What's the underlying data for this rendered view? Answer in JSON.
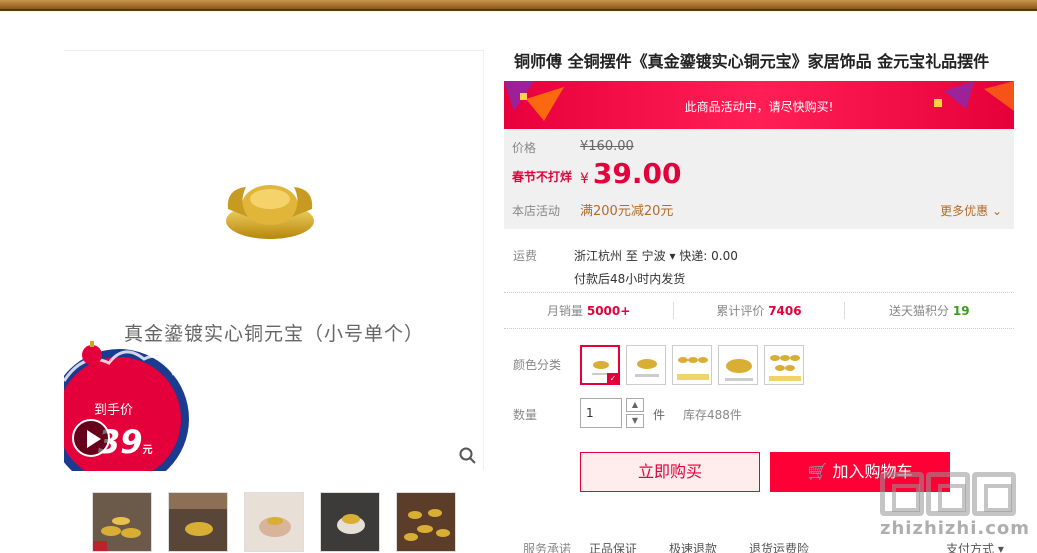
{
  "product": {
    "title": "铜师傅 全铜摆件《真金鎏镀实心铜元宝》家居饰品 金元宝礼品摆件",
    "gallery_caption": "真金鎏镀实心铜元宝（小号单个）",
    "promo_badge": {
      "label": "到手价",
      "price": "39",
      "unit": "元"
    }
  },
  "event_banner": {
    "text": "此商品活动中，请尽快购买!"
  },
  "price_panel": {
    "price_label": "价格",
    "original_price": "¥160.00",
    "promo_label": "春节不打烊",
    "currency": "¥",
    "promo_price": "39.00",
    "shop_event_label": "本店活动",
    "shop_event": "满200元减20元",
    "more_discount": "更多优惠"
  },
  "shipping": {
    "label": "运费",
    "route": "浙江杭州 至 宁波 ▾ 快递: 0.00",
    "time": "付款后48小时内发货"
  },
  "stats": [
    {
      "label": "月销量",
      "value": "5000+"
    },
    {
      "label": "累计评价",
      "value": "7406"
    },
    {
      "label": "送天猫积分",
      "value": "19"
    }
  ],
  "color": {
    "label": "颜色分类"
  },
  "quantity": {
    "label": "数量",
    "value": "1",
    "unit": "件",
    "stock": "库存488件"
  },
  "actions": {
    "buy_now": "立即购买",
    "add_cart": "加入购物车"
  },
  "service": {
    "label": "服务承诺",
    "items": [
      "正品保证",
      "极速退款",
      "退货运费险"
    ],
    "pay_method": "支付方式 ▾"
  },
  "watermark": {
    "url": "zhizhizhi.com"
  },
  "colors": {
    "accent": "#e4003a",
    "brand_red": "#ff0036",
    "gold": "#d4a520"
  }
}
